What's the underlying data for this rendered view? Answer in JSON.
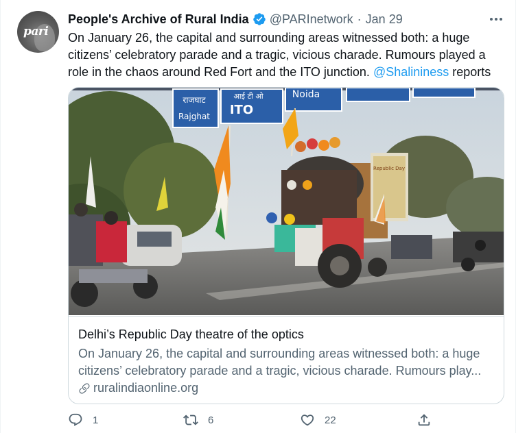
{
  "tweet": {
    "author_name": "People's Archive of Rural India",
    "handle": "@PARInetwork",
    "separator": "·",
    "date": "Jan 29",
    "avatar_logo": "pari",
    "text_before_mention": "On January 26, the capital and surrounding areas witnessed both: a huge citizens’ celebratory parade and a tragic, vicious charade. Rumours played a role in the chaos around Red Fort and the ITO junction. ",
    "mention": "@Shalininess",
    "text_after_mention": " reports",
    "icons": {
      "verified": "verified-badge-icon",
      "more": "more-options-icon",
      "link": "link-icon",
      "reply": "reply-icon",
      "retweet": "retweet-icon",
      "like": "like-icon",
      "share": "share-icon"
    },
    "colors": {
      "accent": "#1d9bf0",
      "text": "#0f1419",
      "secondary": "#536471",
      "border": "#cfd9de"
    }
  },
  "card": {
    "title": "Delhi’s Republic Day theatre of the optics",
    "description_line1": "On January 26, the capital and surrounding areas witnessed both: a huge",
    "description_line2": "citizens’ celebratory parade and a tragic, vicious charade. Rumours play...",
    "domain": "ruralindiaonline.org",
    "photo_signs": {
      "sign1_hindi": "राजघाट",
      "sign1_english": "Rajghat",
      "sign2_hindi": "आई टी ओ",
      "sign2_english": "ITO",
      "sign3_english": "Noida",
      "hoarding": "Republic Day"
    }
  },
  "actions": {
    "replies": "1",
    "retweets": "6",
    "likes": "22"
  }
}
